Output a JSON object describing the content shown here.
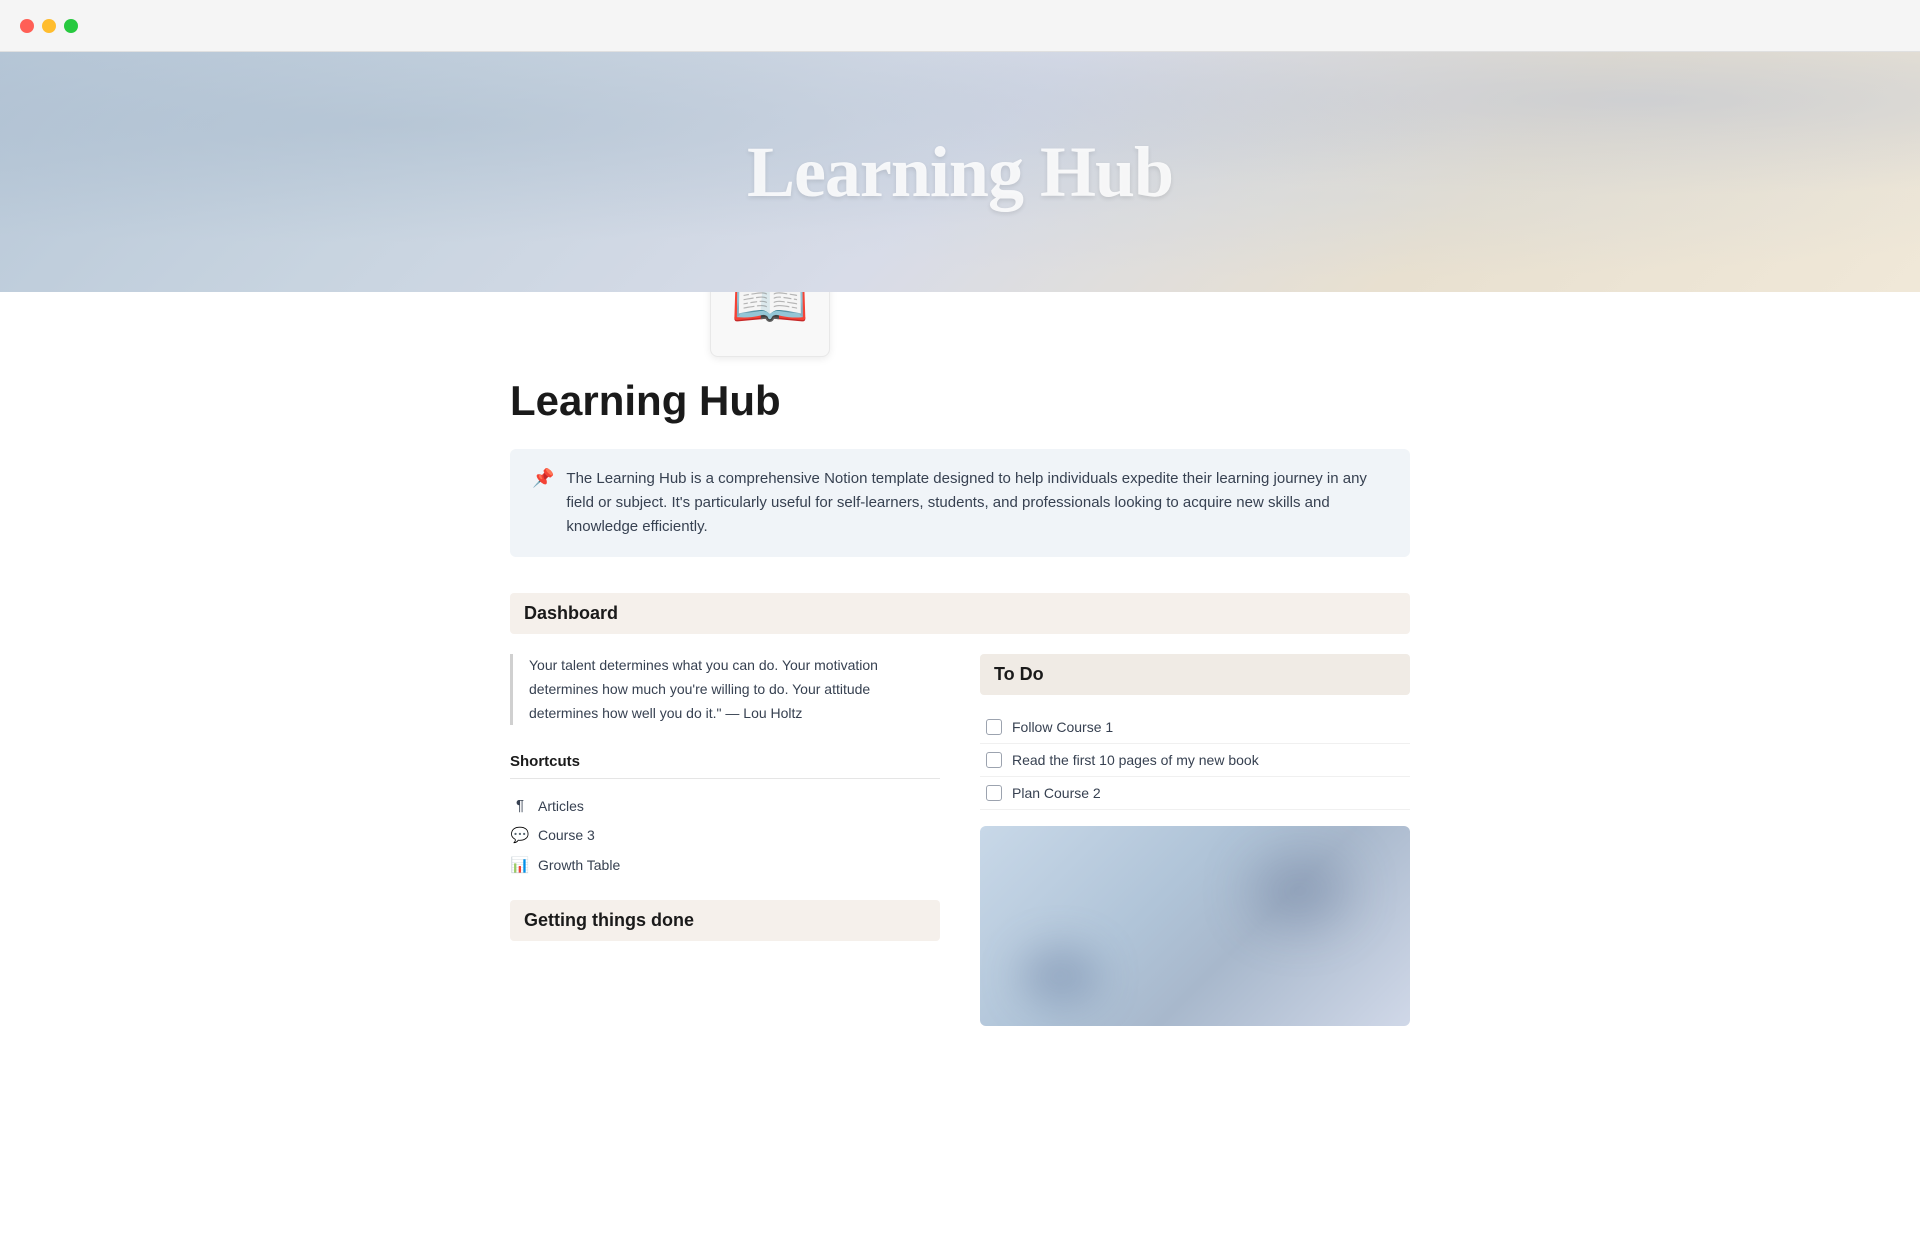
{
  "window": {
    "traffic_lights": {
      "red_label": "close",
      "yellow_label": "minimize",
      "green_label": "maximize"
    }
  },
  "hero": {
    "title": "Learning Hub"
  },
  "page": {
    "title": "Learning Hub",
    "icon": "📖",
    "callout": {
      "icon": "📌",
      "text": "The Learning Hub is a comprehensive Notion template designed to help individuals expedite their learning journey in any field or subject. It's particularly useful for self-learners, students, and professionals looking to acquire new skills and knowledge efficiently."
    }
  },
  "dashboard": {
    "header": "Dashboard",
    "quote": "Your talent determines what you can do. Your motivation determines how much you're willing to do. Your attitude determines how well you do it.\" — Lou Holtz",
    "shortcuts": {
      "header": "Shortcuts",
      "items": [
        {
          "icon": "¶",
          "label": "Articles"
        },
        {
          "icon": "💬",
          "label": "Course 3"
        },
        {
          "icon": "📊",
          "label": "Growth Table"
        }
      ]
    },
    "getting_things_done": {
      "header": "Getting things done"
    },
    "todo": {
      "header": "To Do",
      "items": [
        {
          "label": "Follow Course 1",
          "checked": false
        },
        {
          "label": "Read the first 10 pages of my new book",
          "checked": false
        },
        {
          "label": "Plan Course 2",
          "checked": false
        }
      ]
    }
  }
}
